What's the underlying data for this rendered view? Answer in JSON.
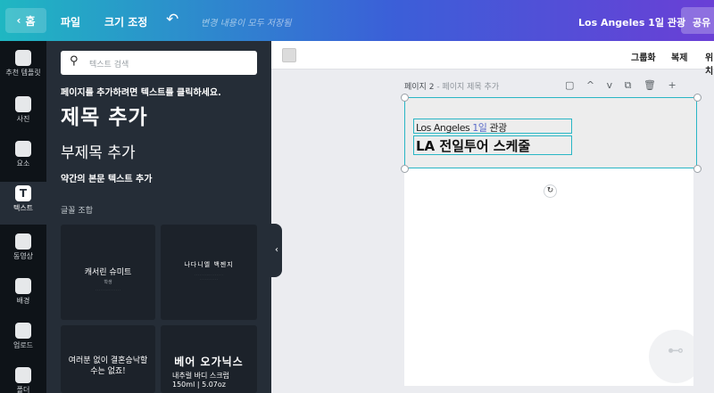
{
  "topbar": {
    "home": "홈",
    "file": "파일",
    "resize": "크기 조정",
    "saved_status": "변경 내용이 모두 저장됨",
    "doc_title": "Los Angeles 1일 관광",
    "share": "공유"
  },
  "rail": [
    {
      "label": "추천 템플릿",
      "icon": "template-icon"
    },
    {
      "label": "사진",
      "icon": "photo-icon"
    },
    {
      "label": "요소",
      "icon": "elements-icon"
    },
    {
      "label": "텍스트",
      "icon": "text-icon"
    },
    {
      "label": "동영상",
      "icon": "video-icon"
    },
    {
      "label": "배경",
      "icon": "background-icon"
    },
    {
      "label": "업로드",
      "icon": "upload-icon"
    },
    {
      "label": "폴더",
      "icon": "folder-icon"
    }
  ],
  "panel": {
    "search_placeholder": "텍스트 검색",
    "hint": "페이지를 추가하려면 텍스트를 클릭하세요.",
    "heading": "제목 추가",
    "subheading": "부제목 추가",
    "body": "약간의 본문 텍스트 추가",
    "combos_label": "글꼴 조합",
    "cards": [
      {
        "title": "캐서린 슈미트",
        "sub": "학생"
      },
      {
        "title": "나다니엘 백젠지",
        "sub": ""
      },
      {
        "title": "여러분 없이 결혼승낙할 수는 없죠!",
        "sub": ""
      },
      {
        "title": "베어 오가닉스",
        "sub": "내추럴 바디 스크럽",
        "size": "150ml | 5.07oz"
      }
    ]
  },
  "toolbar": {
    "group": "그룹화",
    "duplicate": "복제",
    "position": "위치"
  },
  "canvas": {
    "page_label": "페이지 2",
    "page_title_hint": "- 페이지 제목 추가",
    "line1_a": "Los Angeles",
    "line1_b": "1일",
    "line1_c": "관광",
    "line2": "LA 전일투어 스케줄"
  },
  "colors": {
    "selection": "#29b6c5",
    "panel_bg": "#252d37",
    "rail_bg": "#0e1318"
  }
}
